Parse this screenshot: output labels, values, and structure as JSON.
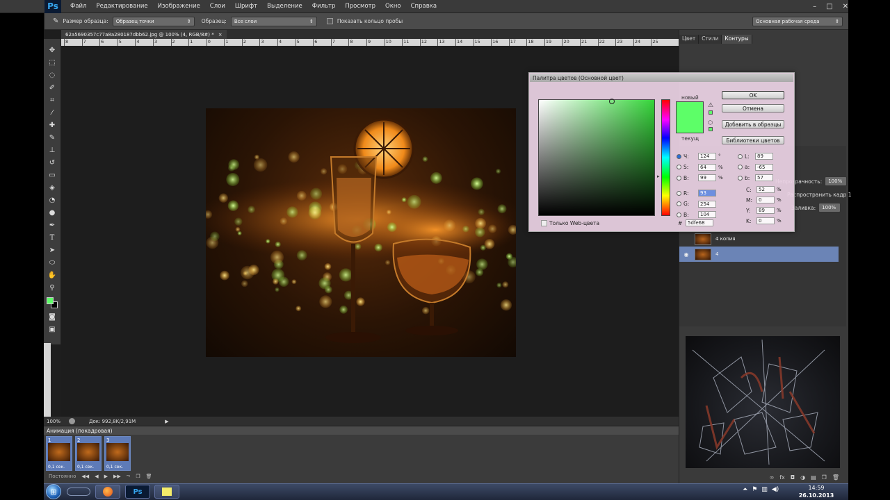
{
  "app": {
    "logo": "Ps",
    "menu": [
      "Файл",
      "Редактирование",
      "Изображение",
      "Слои",
      "Шрифт",
      "Выделение",
      "Фильтр",
      "Просмотр",
      "Окно",
      "Справка"
    ],
    "window_controls": [
      "–",
      "□",
      "✕"
    ]
  },
  "options_bar": {
    "sample_size_label": "Размер образца:",
    "sample_size_value": "Образец точки",
    "sample_label": "Образец:",
    "sample_value": "Все слои",
    "show_ring_label": "Показать кольцо пробы",
    "workspace": "Основная рабочая среда"
  },
  "document": {
    "tab_title": "62a5690357c77a8a280187dbb62.jpg @ 100% (4, RGB/8#) *",
    "close": "×",
    "ruler_top_ticks": [
      "8",
      "7",
      "6",
      "5",
      "4",
      "3",
      "2",
      "1",
      "0",
      "1",
      "2",
      "3",
      "4",
      "5",
      "6",
      "7",
      "8",
      "9",
      "10",
      "11",
      "12",
      "13",
      "14",
      "15",
      "16",
      "17",
      "18",
      "19",
      "20",
      "21",
      "22",
      "23",
      "24",
      "25"
    ],
    "ruler_left_ticks": [
      "5",
      "4",
      "3",
      "2",
      "1"
    ]
  },
  "status_bar": {
    "zoom": "100%",
    "doc_info": "Док: 992,8K/2,91M"
  },
  "animation": {
    "title": "Анимация (покадровая)",
    "frames": [
      {
        "num": "1",
        "delay": "0,1 сек."
      },
      {
        "num": "2",
        "delay": "0,1 сек."
      },
      {
        "num": "3",
        "delay": "0,1 сек."
      }
    ],
    "loop": "Постоянно"
  },
  "right_panel": {
    "tabs": [
      "Цвет",
      "Стили",
      "Контуры"
    ],
    "opacity_label": "Непрозрачность:",
    "opacity_value": "100%",
    "propagate_label": "Распространить кадр 1",
    "fill_label": "Заливка:",
    "fill_value": "100%",
    "layers": [
      {
        "name": "4 копия",
        "visible": false
      },
      {
        "name": "4",
        "visible": true
      }
    ]
  },
  "color_picker": {
    "title": "Палитра цветов (Основной цвет)",
    "new_label": "новый",
    "current_label": "текущ",
    "web_only_label": "Только Web-цвета",
    "buttons": {
      "ok": "OK",
      "cancel": "Отмена",
      "add_swatches": "Добавить в образцы",
      "libraries": "Библиотеки цветов"
    },
    "hsb": [
      {
        "label": "Ч:",
        "value": "124",
        "unit": "°",
        "on": true
      },
      {
        "label": "S:",
        "value": "64",
        "unit": "%",
        "on": false
      },
      {
        "label": "В:",
        "value": "99",
        "unit": "%",
        "on": false
      }
    ],
    "rgb": [
      {
        "label": "R:",
        "value": "93",
        "unit": "",
        "on": false,
        "sel": true
      },
      {
        "label": "G:",
        "value": "254",
        "unit": "",
        "on": false,
        "sel": false
      },
      {
        "label": "В:",
        "value": "104",
        "unit": "",
        "on": false,
        "sel": false
      }
    ],
    "lab": [
      {
        "label": "L:",
        "value": "89",
        "unit": ""
      },
      {
        "label": "a:",
        "value": "-65",
        "unit": ""
      },
      {
        "label": "b:",
        "value": "57",
        "unit": ""
      }
    ],
    "cmyk": [
      {
        "label": "C:",
        "value": "52",
        "unit": "%"
      },
      {
        "label": "M:",
        "value": "0",
        "unit": "%"
      },
      {
        "label": "Y:",
        "value": "89",
        "unit": "%"
      },
      {
        "label": "K:",
        "value": "0",
        "unit": "%"
      }
    ],
    "hex_label": "#",
    "hex_value": "5dfe68",
    "color_hex": "#5dfe68"
  },
  "taskbar": {
    "time": "14:59",
    "date": "26.10.2013",
    "ps_label": "Ps"
  }
}
